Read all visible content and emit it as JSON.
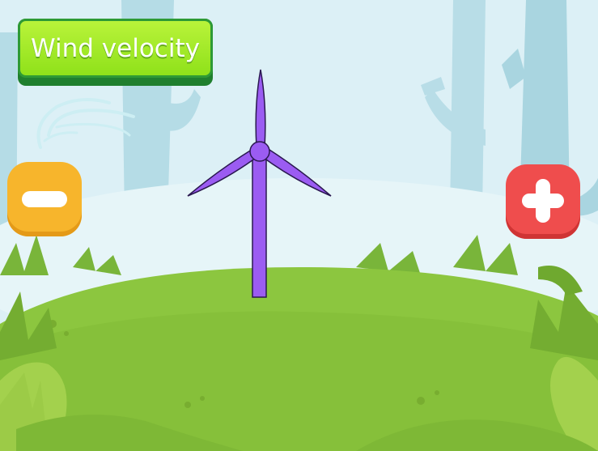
{
  "title_button": {
    "label": "Wind velocity"
  },
  "controls": {
    "decrease": {
      "icon": "minus-icon",
      "color": "#f7b52c"
    },
    "increase": {
      "icon": "plus-icon",
      "color": "#ef4d4d"
    }
  },
  "wind_icon": {
    "icon": "wind-gust-icon"
  },
  "turbine": {
    "icon": "wind-turbine-icon",
    "color": "#9b5cf2"
  },
  "colors": {
    "sky": "#dcf0f6",
    "grass": "#8cc63f",
    "title_button": "#a6ea2a"
  }
}
